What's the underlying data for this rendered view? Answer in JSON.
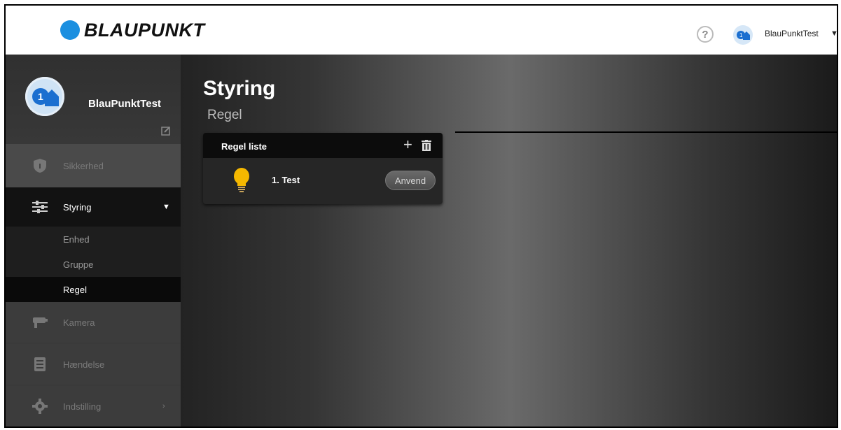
{
  "header": {
    "logo_text": "BLAUPUNKT",
    "help_label": "?",
    "username": "BlauPunktTest"
  },
  "sidebar": {
    "profile_name": "BlauPunktTest",
    "items": [
      {
        "label": "Sikkerhed",
        "icon": "shield-icon"
      },
      {
        "label": "Styring",
        "icon": "sliders-icon"
      },
      {
        "label": "Kamera",
        "icon": "camera-icon"
      },
      {
        "label": "Hændelse",
        "icon": "event-list-icon"
      },
      {
        "label": "Indstilling",
        "icon": "gear-icon"
      }
    ],
    "sub_items": [
      {
        "label": "Enhed"
      },
      {
        "label": "Gruppe"
      },
      {
        "label": "Regel",
        "active": true
      }
    ]
  },
  "main": {
    "title": "Styring",
    "subtitle": "Regel",
    "panel": {
      "title": "Regel liste",
      "add_label": "+",
      "rules": [
        {
          "name": "1. Test",
          "button": "Anvend",
          "icon": "lightbulb-icon"
        }
      ]
    }
  },
  "colors": {
    "brand_blue": "#1b8fe0",
    "sidebar_bg": "#3a3a3a",
    "active_bg": "#121212"
  }
}
